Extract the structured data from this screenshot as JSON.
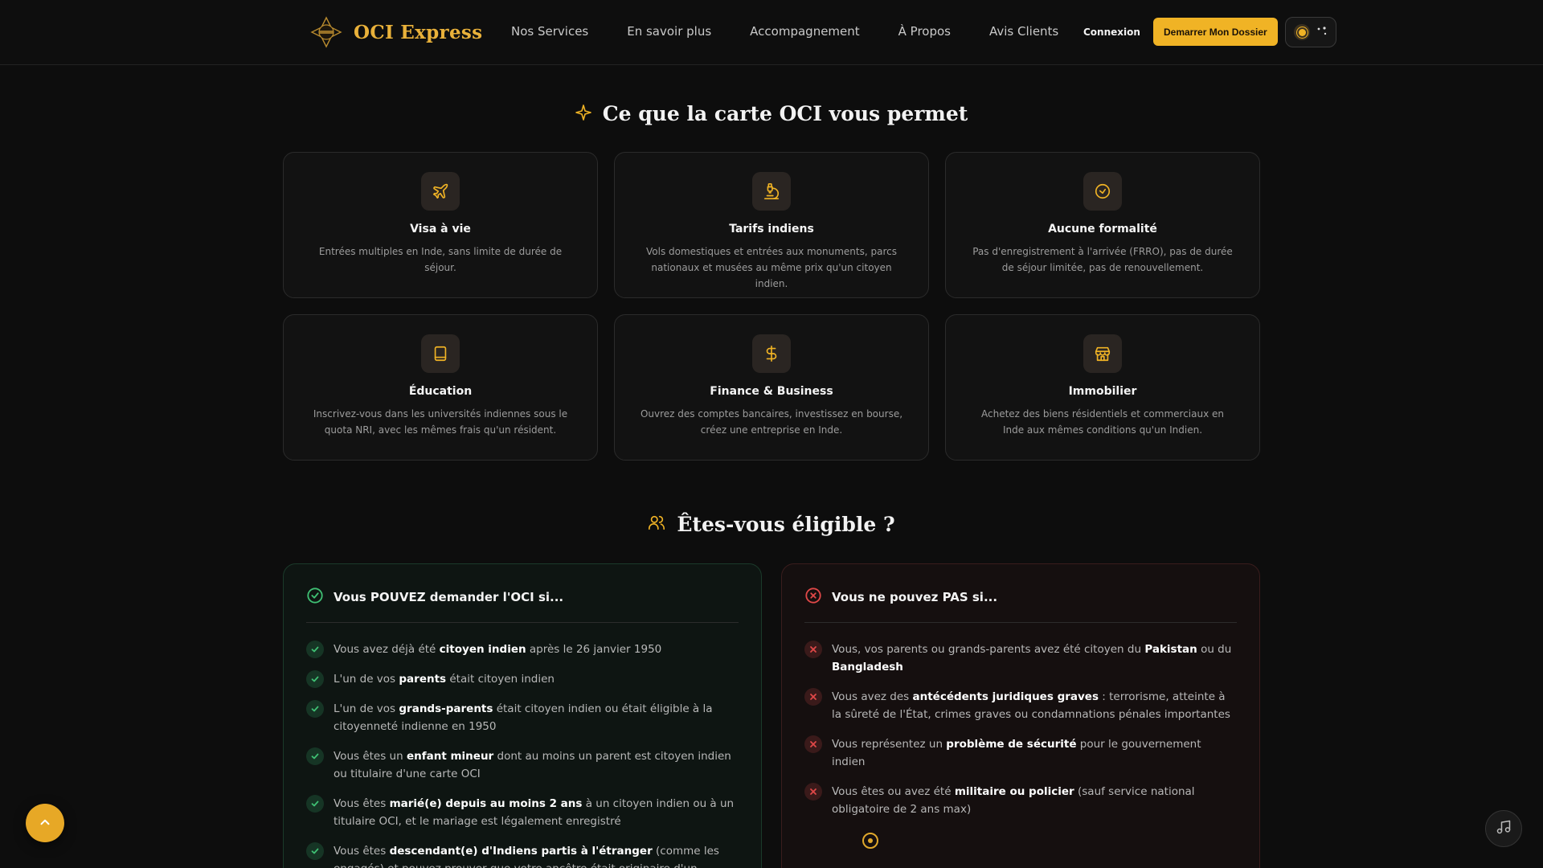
{
  "brand": {
    "name": "OCI Express",
    "accent": "#f0b325"
  },
  "nav": {
    "items": [
      "Nos Services",
      "En savoir plus",
      "Accompagnement",
      "À Propos",
      "Avis Clients"
    ],
    "login": "Connexion",
    "cta": "Demarrer Mon Dossier"
  },
  "benefits": {
    "title": "Ce que la carte OCI vous permet",
    "icon": "sparkle-icon",
    "cards": [
      {
        "icon": "plane-icon",
        "title": "Visa à vie",
        "desc": "Entrées multiples en Inde, sans limite de durée de séjour."
      },
      {
        "icon": "monument-icon",
        "title": "Tarifs indiens",
        "desc": "Vols domestiques et entrées aux monuments, parcs nationaux et musées au même prix qu'un citoyen indien."
      },
      {
        "icon": "check-circle-icon",
        "title": "Aucune formalité",
        "desc": "Pas d'enregistrement à l'arrivée (FRRO), pas de durée de séjour limitée, pas de renouvellement."
      },
      {
        "icon": "book-icon",
        "title": "Éducation",
        "desc": "Inscrivez-vous dans les universités indiennes sous le quota NRI, avec les mêmes frais qu'un résident."
      },
      {
        "icon": "dollar-icon",
        "title": "Finance & Business",
        "desc": "Ouvrez des comptes bancaires, investissez en bourse, créez une entreprise en Inde."
      },
      {
        "icon": "store-icon",
        "title": "Immobilier",
        "desc": "Achetez des biens résidentiels et commerciaux en Inde aux mêmes conditions qu'un Indien."
      }
    ]
  },
  "eligibility": {
    "title": "Êtes-vous éligible ?",
    "icon": "users-icon",
    "yes": {
      "title": "Vous POUVEZ demander l'OCI si...",
      "color": "#3fbf73",
      "items": [
        [
          "Vous avez déjà été ",
          "citoyen indien",
          " après le 26 janvier 1950"
        ],
        [
          "L'un de vos ",
          "parents",
          " était citoyen indien"
        ],
        [
          "L'un de vos ",
          "grands-parents",
          " était citoyen indien ou était éligible à la citoyenneté indienne en 1950"
        ],
        [
          "Vous êtes un ",
          "enfant mineur",
          " dont au moins un parent est citoyen indien ou titulaire d'une carte OCI"
        ],
        [
          "Vous êtes ",
          "marié(e) depuis au moins 2 ans",
          " à un citoyen indien ou à un titulaire OCI, et le mariage est légalement enregistré"
        ],
        [
          "Vous êtes ",
          "descendant(e) d'Indiens partis à l'étranger",
          " (comme les engagés) et pouvez prouver que votre ancêtre était originaire d'un territoire faisant"
        ]
      ]
    },
    "no": {
      "title": "Vous ne pouvez PAS si...",
      "color": "#e04848",
      "items": [
        [
          "Vous, vos parents ou grands-parents avez été citoyen du ",
          "Pakistan",
          " ou du ",
          "Bangladesh",
          ""
        ],
        [
          "Vous avez des ",
          "antécédents juridiques graves",
          " : terrorisme, atteinte à la sûreté de l'État, crimes graves ou condamnations pénales importantes"
        ],
        [
          "Vous représentez un ",
          "problème de sécurité",
          " pour le gouvernement indien"
        ],
        [
          "Vous êtes ou avez été ",
          "militaire ou policier",
          " (sauf service national obligatoire de 2 ans max)"
        ]
      ]
    }
  }
}
